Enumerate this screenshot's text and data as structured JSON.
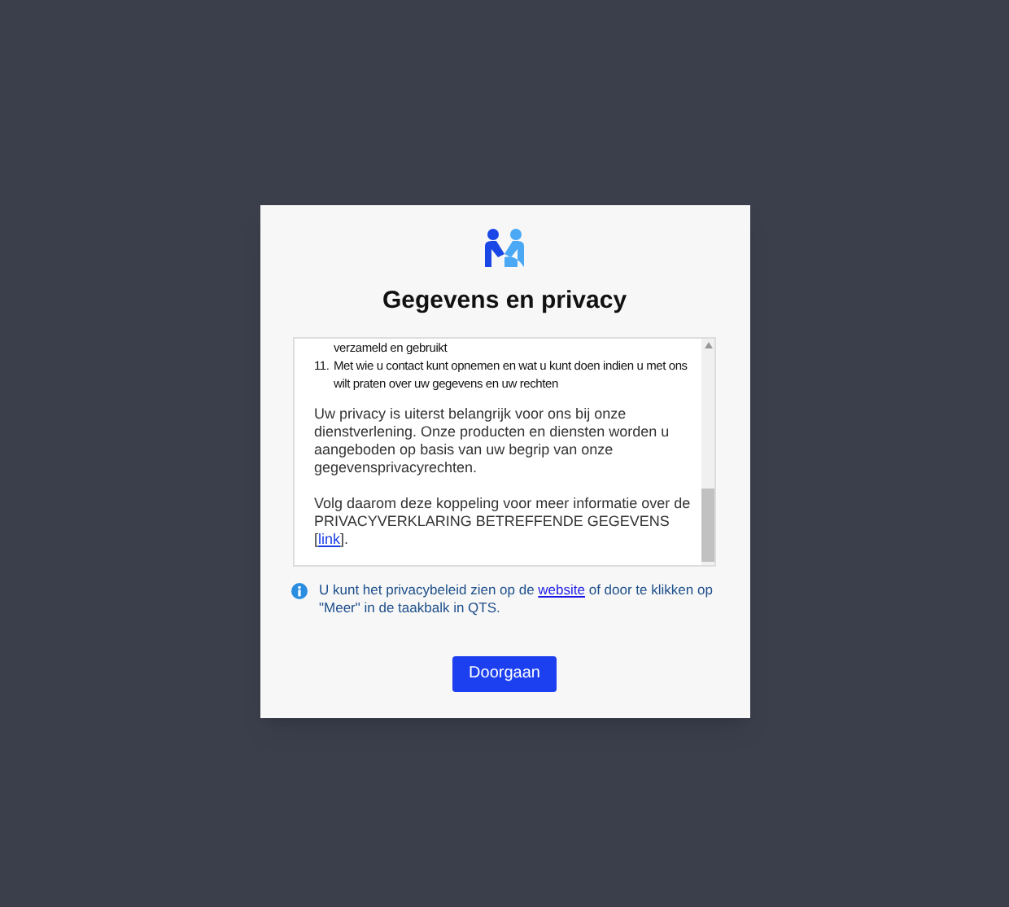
{
  "dialog": {
    "title": "Gegevens en privacy",
    "scroll_content": {
      "list_items": [
        {
          "text": "verzameld en gebruikt"
        },
        {
          "number": "11.",
          "text": "Met wie u contact kunt opnemen en wat u kunt doen indien u met ons wilt praten over uw gegevens en uw rechten"
        }
      ],
      "paragraph": "Uw privacy is uiterst belangrijk voor ons bij onze dienstverlening. Onze producten en diensten worden u aangeboden op basis van uw begrip van onze gegevensprivacyrechten.",
      "link_paragraph": {
        "before": "Volg daarom deze koppeling voor meer informatie over de PRIVACYVERKLARING BETREFFENDE GEGEVENS [",
        "link": "link",
        "after": "]."
      }
    },
    "note": {
      "before": "U kunt het privacybeleid zien op de ",
      "link": "website",
      "after": " of door te klikken op \"Meer\" in de taakbalk in QTS."
    },
    "button": "Doorgaan"
  }
}
